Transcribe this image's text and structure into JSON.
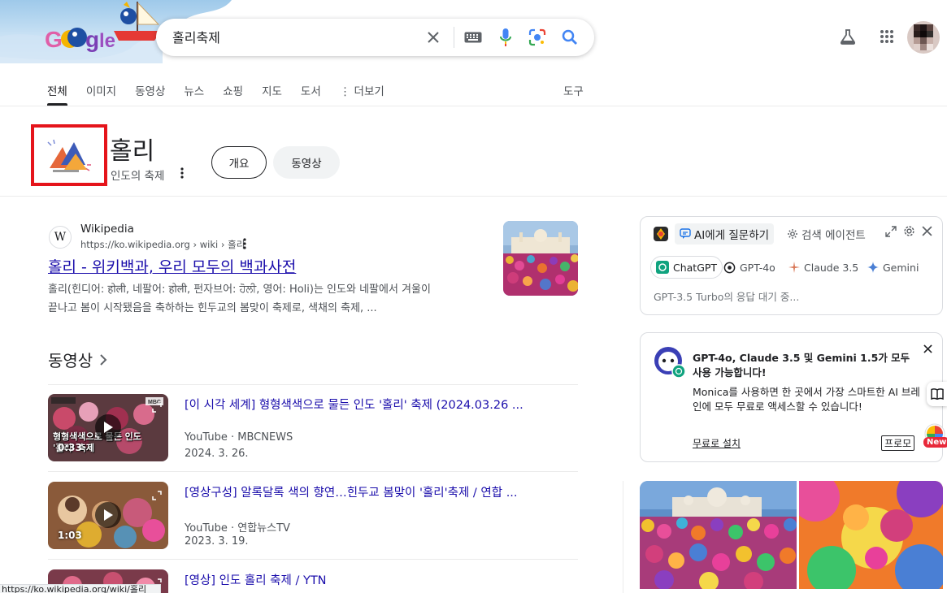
{
  "search": {
    "query": "홀리축제"
  },
  "icons": {
    "clear": "close-icon",
    "keyboard": "keyboard-icon",
    "voice": "microphone-icon",
    "lens": "camera-lens-icon",
    "search": "search-icon",
    "labs": "flask-icon",
    "apps": "apps-grid-icon"
  },
  "tabs": [
    {
      "label": "전체",
      "active": true
    },
    {
      "label": "이미지"
    },
    {
      "label": "동영상"
    },
    {
      "label": "뉴스"
    },
    {
      "label": "쇼핑"
    },
    {
      "label": "지도"
    },
    {
      "label": "도서"
    },
    {
      "label": "⋮ 더보기"
    }
  ],
  "tools_label": "도구",
  "entity": {
    "title": "홀리",
    "subtitle": "인도의 축제",
    "chips": [
      "개요",
      "동영상"
    ]
  },
  "wiki": {
    "site": "Wikipedia",
    "url": "https://ko.wikipedia.org › wiki › 홀리",
    "title": "홀리 - 위키백과, 우리 모두의 백과사전",
    "snippet_1": "홀리(힌디어: होली, 네팔어: होली, 펀자브어: ਹੋਲੀ, 영어: Holi)는 인도와 네팔에서 겨울이",
    "snippet_2": "끝나고 봄이 시작됐음을 축하하는 힌두교의 봄맞이 축제로, 색채의 축제, ..."
  },
  "videos": {
    "heading": "동영상",
    "items": [
      {
        "title": "[이 시각 세계] 형형색색으로 물든 인도 '홀리' 축제 (2024.03.26 ...",
        "source": "YouTube · MBCNEWS",
        "date": "2024. 3. 26.",
        "duration": "0:33",
        "overlay": "형형색색으로 물든 인도 '홀리' 축제"
      },
      {
        "title": "[영상구성] 알록달록 색의 향연…힌두교 봄맞이 '홀리'축제 / 연합 ...",
        "source": "YouTube · 연합뉴스TV",
        "date": "2023. 3. 19.",
        "duration": "1:03"
      },
      {
        "title": "[영상] 인도 홀리 축제 / YTN"
      }
    ]
  },
  "status_url": "https://ko.wikipedia.org/wiki/홀리",
  "ai_panel": {
    "tab_ask": "AI에게 질문하기",
    "tab_agent": "검색 에이전트",
    "models": [
      "ChatGPT",
      "GPT-4o",
      "Claude 3.5",
      "Gemini"
    ],
    "waiting": "GPT-3.5 Turbo의 응답 대기 중..."
  },
  "promo": {
    "title": "GPT-4o, Claude 3.5 및 Gemini 1.5가 모두 사용 가능합니다!",
    "body": "Monica를 사용하면 한 곳에서 가장 스마트한 AI 브레인에 모두 무료로 액세스할 수 있습니다!",
    "install": "무료로 설치",
    "pro": "프로모",
    "new_badge": "New"
  },
  "colors": {
    "link": "#1a0dab",
    "highlight_box": "#e5141b",
    "google_blue": "#4285f4",
    "google_red": "#ea4335",
    "google_yellow": "#fbbc05",
    "google_green": "#34a853"
  }
}
